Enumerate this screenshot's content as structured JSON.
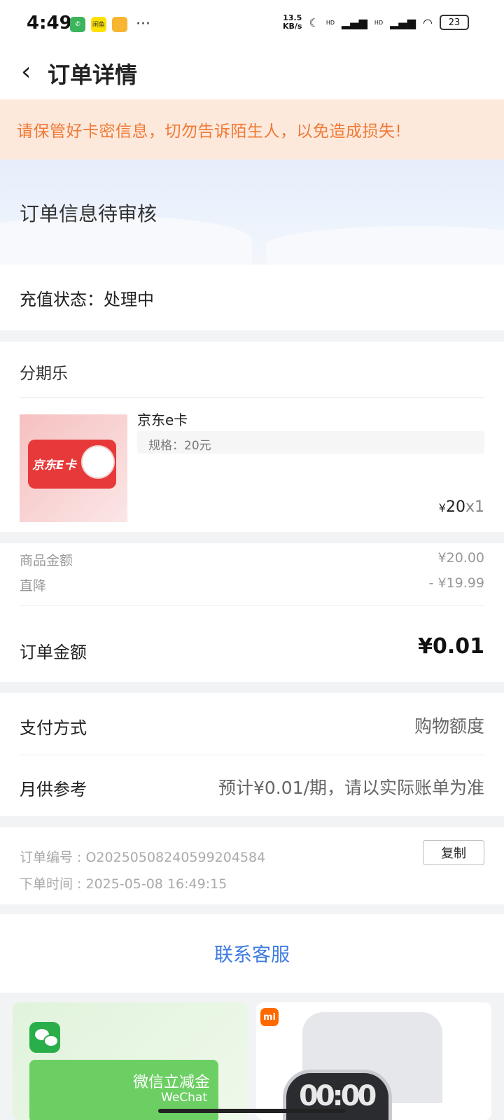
{
  "status_bar": {
    "time": "4:49",
    "speed_value": "13.5",
    "speed_unit": "KB/s",
    "hd1": "HD",
    "hd2": "HD",
    "battery": "23",
    "app_icon_2_text": "闲鱼"
  },
  "header": {
    "back_icon": "‹",
    "title": "订单详情"
  },
  "warning": {
    "text": "请保管好卡密信息，切勿告诉陌生人，以免造成损失!"
  },
  "order_status": {
    "title": "订单信息待审核"
  },
  "recharge": {
    "status_text": "充值状态：处理中"
  },
  "product": {
    "shop": "分期乐",
    "thumb_label": "京东E卡",
    "name": "京东e卡",
    "spec": "规格：20元",
    "currency": "¥",
    "price": "20",
    "qty": "x1"
  },
  "amounts": {
    "goods_label": "商品金额",
    "goods_value": "¥20.00",
    "discount_label": "直降",
    "discount_value": "- ¥19.99",
    "order_label": "订单金额",
    "order_value": "¥0.01"
  },
  "payment": {
    "method_label": "支付方式",
    "method_value": "购物额度",
    "monthly_label": "月供参考",
    "monthly_value": "预计¥0.01/期，请以实际账单为准"
  },
  "order_info": {
    "number": "订单编号 : O20250508240599204584",
    "time": "下单时间 : 2025-05-08 16:49:15",
    "copy_label": "复制"
  },
  "service": {
    "label": "联系客服"
  },
  "ads": {
    "left_title": "微信立减金",
    "left_sub": "WeChat",
    "right_logo": "mi",
    "watch_text": "00:00"
  },
  "colors": {
    "warning_text": "#ef7a35",
    "warning_bg": "#fde8dc",
    "link_blue": "#3e7be1",
    "accent_red": "#e8393a"
  },
  "icons": [
    "phone-app-icon",
    "xianyu-app-icon",
    "notes-app-icon",
    "moon-icon",
    "signal-icon",
    "wifi-icon",
    "battery-icon",
    "back-arrow-icon",
    "wechat-icon",
    "xiaomi-logo-icon"
  ]
}
